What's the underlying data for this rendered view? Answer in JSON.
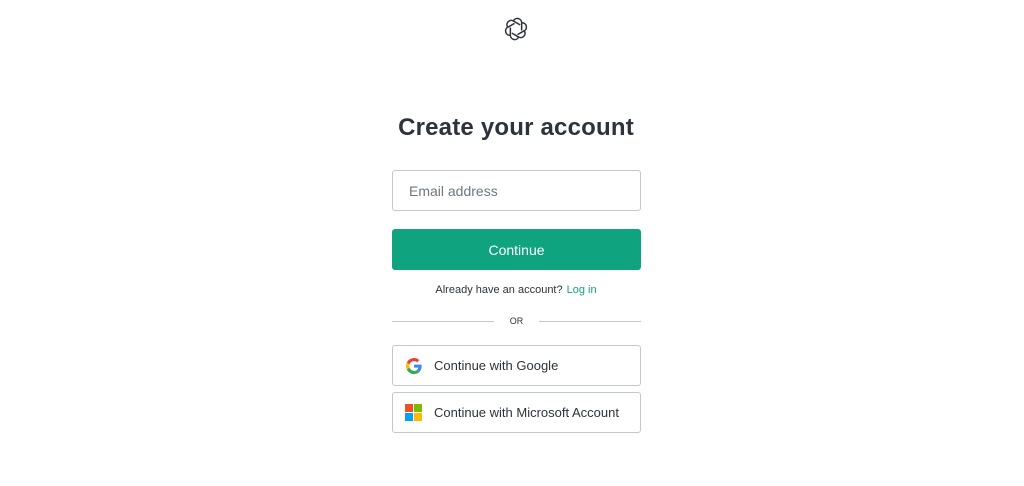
{
  "header": {
    "logo_icon": "openai-logo-icon"
  },
  "main": {
    "title": "Create your account",
    "email_placeholder": "Email address",
    "email_value": "",
    "continue_label": "Continue",
    "login_prompt": "Already have an account?",
    "login_link": "Log in",
    "divider_text": "OR",
    "google_label": "Continue with Google",
    "microsoft_label": "Continue with Microsoft Account"
  },
  "colors": {
    "accent": "#10a37f",
    "text": "#2d333a",
    "border": "#c2c8d0",
    "microsoft_red": "#f25022",
    "microsoft_green": "#7fba00",
    "microsoft_blue": "#00a4ef",
    "microsoft_yellow": "#ffb900"
  }
}
